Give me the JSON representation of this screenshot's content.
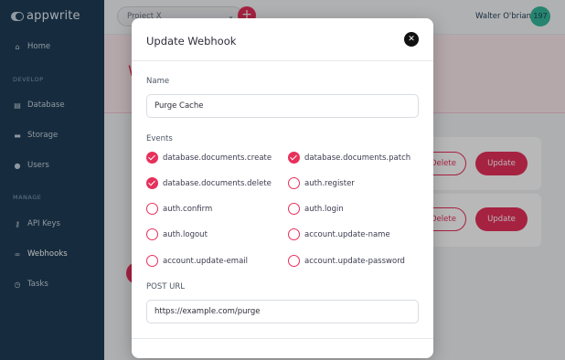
{
  "app": {
    "logo_text": "appwrite"
  },
  "sidebar": {
    "items_top": [
      {
        "label": "Home",
        "icon": "home-icon"
      }
    ],
    "section_develop": "DEVELOP",
    "items_develop": [
      {
        "label": "Database",
        "icon": "database-icon"
      },
      {
        "label": "Storage",
        "icon": "folder-icon"
      },
      {
        "label": "Users",
        "icon": "users-icon"
      }
    ],
    "section_manage": "MANAGE",
    "items_manage": [
      {
        "label": "API Keys",
        "icon": "key-icon"
      },
      {
        "label": "Webhooks",
        "icon": "link-icon"
      },
      {
        "label": "Tasks",
        "icon": "clock-icon"
      }
    ]
  },
  "topbar": {
    "project": "Project X",
    "add_symbol": "+",
    "user_name": "Walter O'brian",
    "avatar_initials": "197"
  },
  "background": {
    "header_title": "W",
    "rows": [
      {
        "delete_label": "Delete",
        "update_label": "Update"
      },
      {
        "delete_label": "Delete",
        "update_label": "Update"
      }
    ]
  },
  "modal": {
    "title": "Update Webhook",
    "close_symbol": "✕",
    "name_label": "Name",
    "name_value": "Purge Cache",
    "events_label": "Events",
    "events": [
      {
        "label": "database.documents.create",
        "checked": true
      },
      {
        "label": "database.documents.patch",
        "checked": true
      },
      {
        "label": "database.documents.delete",
        "checked": true
      },
      {
        "label": "auth.register",
        "checked": false
      },
      {
        "label": "auth.confirm",
        "checked": false
      },
      {
        "label": "auth.login",
        "checked": false
      },
      {
        "label": "auth.logout",
        "checked": false
      },
      {
        "label": "account.update-name",
        "checked": false
      },
      {
        "label": "account.update-email",
        "checked": false
      },
      {
        "label": "account.update-password",
        "checked": false
      }
    ],
    "url_label": "POST URL",
    "url_value": "https://example.com/purge"
  },
  "colors": {
    "accent": "#e7305b",
    "sidebar": "#1f3d56",
    "avatar": "#35b89a"
  }
}
